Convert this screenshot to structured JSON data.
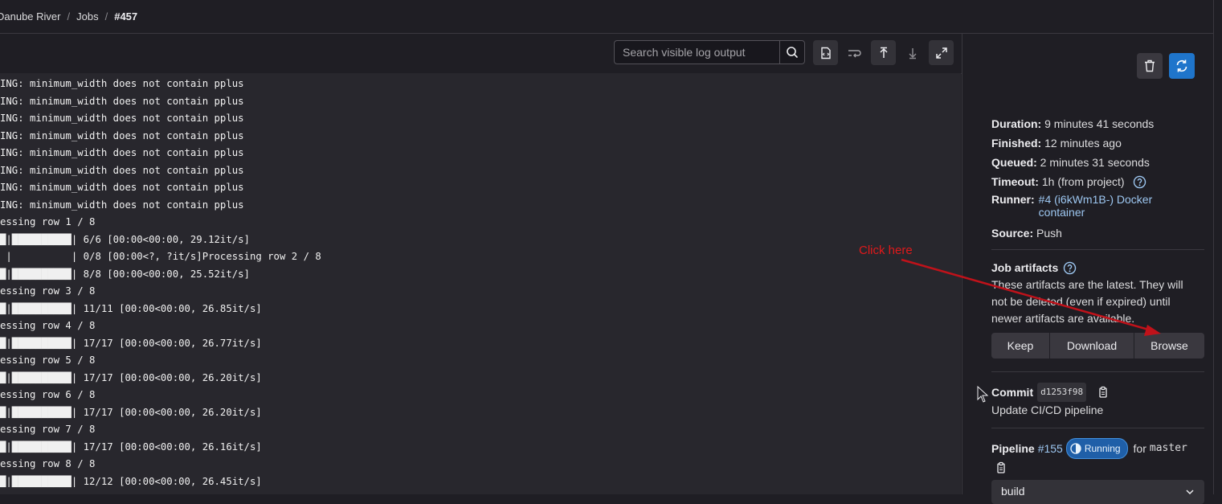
{
  "breadcrumb": {
    "items": [
      "Danube River",
      "Jobs",
      "#457"
    ]
  },
  "log_toolbar": {
    "search_placeholder": "Search visible log output",
    "buttons": [
      "search-icon",
      "raw-log-icon",
      "wrap-lines-icon",
      "scroll-top-icon",
      "scroll-bottom-icon",
      "fullscreen-icon"
    ]
  },
  "log_lines": [
    "ING: minimum_width does not contain pplus",
    "ING: minimum_width does not contain pplus",
    "ING: minimum_width does not contain pplus",
    "ING: minimum_width does not contain pplus",
    "ING: minimum_width does not contain pplus",
    "ING: minimum_width does not contain pplus",
    "ING: minimum_width does not contain pplus",
    "ING: minimum_width does not contain pplus",
    "essing row 1 / 8",
    "█|██████████| 6/6 [00:00<00:00, 29.12it/s]",
    " |          | 0/8 [00:00<?, ?it/s]Processing row 2 / 8",
    "█|██████████| 8/8 [00:00<00:00, 25.52it/s]",
    "essing row 3 / 8",
    "█|██████████| 11/11 [00:00<00:00, 26.85it/s]",
    "essing row 4 / 8",
    "█|██████████| 17/17 [00:00<00:00, 26.77it/s]",
    "essing row 5 / 8",
    "█|██████████| 17/17 [00:00<00:00, 26.20it/s]",
    "essing row 6 / 8",
    "█|██████████| 17/17 [00:00<00:00, 26.20it/s]",
    "essing row 7 / 8",
    "█|██████████| 17/17 [00:00<00:00, 26.16it/s]",
    "essing row 8 / 8",
    "█|██████████| 12/12 [00:00<00:00, 26.45it/s]"
  ],
  "sidebar": {
    "details": [
      {
        "label": "Duration:",
        "value": "9 minutes 41 seconds"
      },
      {
        "label": "Finished:",
        "value": "12 minutes ago"
      },
      {
        "label": "Queued:",
        "value": "2 minutes 31 seconds"
      },
      {
        "label": "Timeout:",
        "value": "1h (from project)"
      },
      {
        "label": "Runner:",
        "value": "#4 (i6kWm1B-) Docker",
        "value2": "container"
      },
      {
        "label": "Source:",
        "value": "Push"
      }
    ],
    "artifacts": {
      "title": "Job artifacts",
      "desc": [
        "These artifacts are the latest. They will",
        "not be deleted (even if expired) until",
        "newer artifacts are available."
      ],
      "keep": "Keep",
      "download": "Download",
      "browse": "Browse"
    },
    "commit": {
      "label": "Commit",
      "sha": "d1253f98",
      "message": "Update CI/CD pipeline"
    },
    "pipeline": {
      "label": "Pipeline",
      "number": "#155",
      "status": "Running",
      "for": "for",
      "branch": "master"
    },
    "stage_select": "build"
  },
  "annotation": {
    "text": "Click here",
    "color": "#e0191b"
  }
}
